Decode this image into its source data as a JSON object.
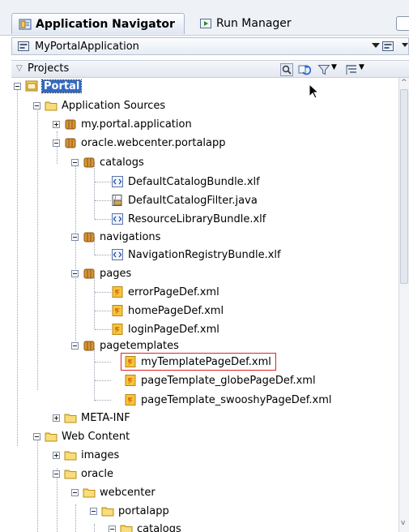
{
  "tabs": {
    "active": "Application Navigator",
    "inactive": "Run Manager"
  },
  "application": {
    "name": "MyPortalApplication"
  },
  "projects": {
    "label": "Projects"
  },
  "tree": {
    "root": "Portal",
    "application_sources": "Application Sources",
    "my_portal_application": "my.portal.application",
    "oracle_webcenter_portalapp": "oracle.webcenter.portalapp",
    "catalogs": "catalogs",
    "default_catalog_bundle": "DefaultCatalogBundle.xlf",
    "default_catalog_filter": "DefaultCatalogFilter.java",
    "resource_library_bundle": "ResourceLibraryBundle.xlf",
    "navigations": "navigations",
    "navigation_registry_bundle": "NavigationRegistryBundle.xlf",
    "pages": "pages",
    "error_page_def": "errorPageDef.xml",
    "home_page_def": "homePageDef.xml",
    "login_page_def": "loginPageDef.xml",
    "pagetemplates": "pagetemplates",
    "my_template_page_def": "myTemplatePageDef.xml",
    "page_template_globe": "pageTemplate_globePageDef.xml",
    "page_template_swooshy": "pageTemplate_swooshyPageDef.xml",
    "meta_inf": "META-INF",
    "web_content": "Web Content",
    "images": "images",
    "oracle": "oracle",
    "webcenter": "webcenter",
    "portalapp": "portalapp",
    "catalogs2": "catalogs"
  },
  "colors": {
    "selection": "#316ac5",
    "highlight_border": "#d9262a",
    "folder": "#f2cf55",
    "package": "#c8842a"
  },
  "icons": {
    "navigator": "navigator-icon",
    "run": "run-icon",
    "app": "application-icon",
    "refresh": "refresh-icon",
    "filter": "filter-icon",
    "sort": "sort-icon"
  }
}
